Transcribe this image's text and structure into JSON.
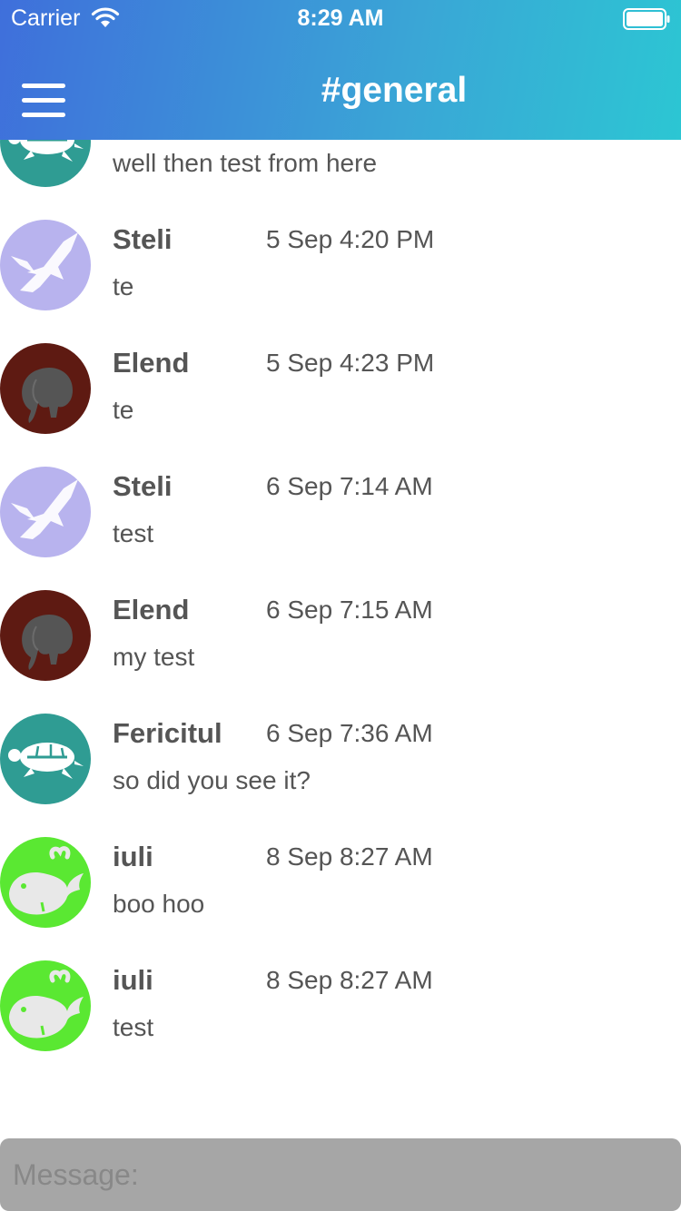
{
  "status_bar": {
    "carrier": "Carrier",
    "time": "8:29 AM",
    "wifi_icon": "wifi-icon",
    "battery_icon": "battery-icon"
  },
  "header": {
    "title": "#general",
    "menu_icon": "hamburger-menu-icon"
  },
  "messages": [
    {
      "author": "",
      "time": "",
      "text": "well then test from here",
      "avatar": "turtle",
      "avatar_color": "#2f9c93"
    },
    {
      "author": "Steli",
      "time": "5 Sep 4:20 PM",
      "text": "te",
      "avatar": "eagle",
      "avatar_color": "#b8b3ee"
    },
    {
      "author": "Elend",
      "time": "5 Sep 4:23 PM",
      "text": "te",
      "avatar": "elephant",
      "avatar_color": "#5e1a12"
    },
    {
      "author": "Steli",
      "time": "6 Sep 7:14 AM",
      "text": "test",
      "avatar": "eagle",
      "avatar_color": "#b8b3ee"
    },
    {
      "author": "Elend",
      "time": "6 Sep 7:15 AM",
      "text": "my test",
      "avatar": "elephant",
      "avatar_color": "#5e1a12"
    },
    {
      "author": "Fericitul",
      "time": "6 Sep 7:36 AM",
      "text": "so did you see it?",
      "avatar": "turtle",
      "avatar_color": "#2f9c93"
    },
    {
      "author": "iuli",
      "time": "8 Sep 8:27 AM",
      "text": "boo hoo",
      "avatar": "whale",
      "avatar_color": "#5ae832"
    },
    {
      "author": "iuli",
      "time": "8 Sep 8:27 AM",
      "text": "test",
      "avatar": "whale",
      "avatar_color": "#5ae832"
    }
  ],
  "composer": {
    "placeholder": "Message:"
  }
}
